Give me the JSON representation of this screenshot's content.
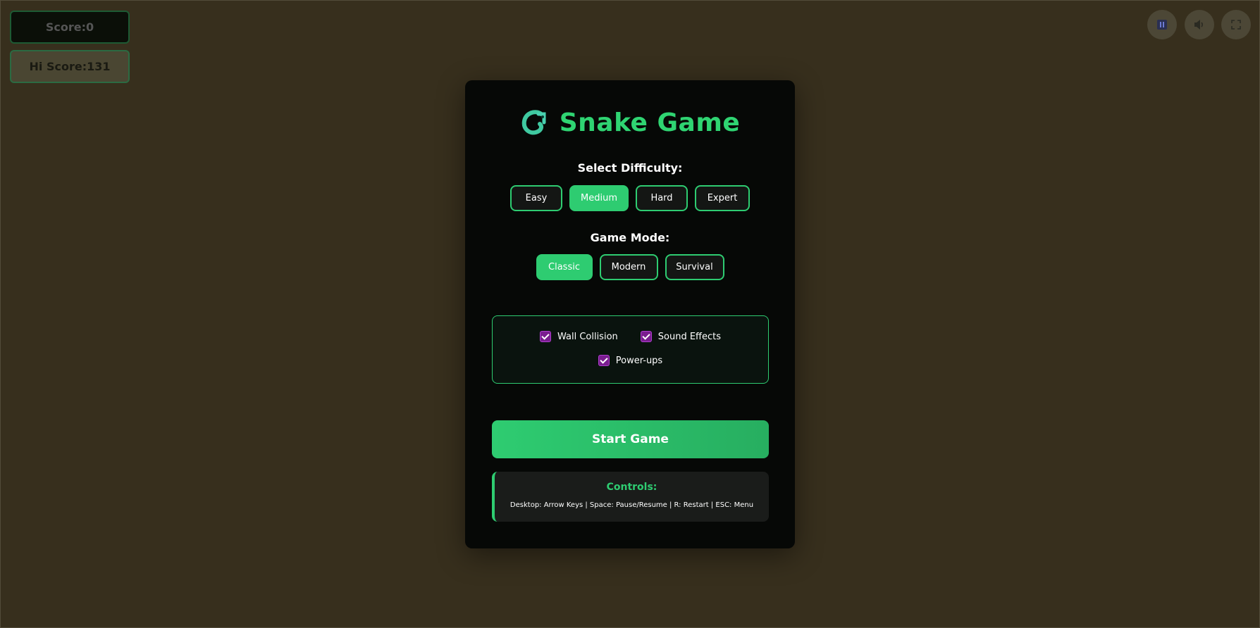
{
  "hud": {
    "score": "Score:0",
    "hi_score": "Hi Score:131"
  },
  "top_buttons": {
    "pause": "pause-icon",
    "sound": "sound-icon",
    "fullscreen": "fullscreen-icon"
  },
  "menu": {
    "title": "Snake Game",
    "difficulty_label": "Select Difficulty:",
    "difficulties": [
      "Easy",
      "Medium",
      "Hard",
      "Expert"
    ],
    "selected_difficulty": "Medium",
    "mode_label": "Game Mode:",
    "modes": [
      "Classic",
      "Modern",
      "Survival"
    ],
    "selected_mode": "Classic",
    "options": {
      "wall_collision": "Wall Collision",
      "sound_effects": "Sound Effects",
      "power_ups": "Power-ups"
    },
    "start_label": "Start Game",
    "controls_title": "Controls:",
    "controls_text": "Desktop: Arrow Keys | Space: Pause/Resume | R: Restart | ESC: Menu"
  },
  "colors": {
    "accent": "#2ecc71",
    "background": "#3a321f",
    "panel": "#060806",
    "checkbox": "#7a1d8f"
  }
}
